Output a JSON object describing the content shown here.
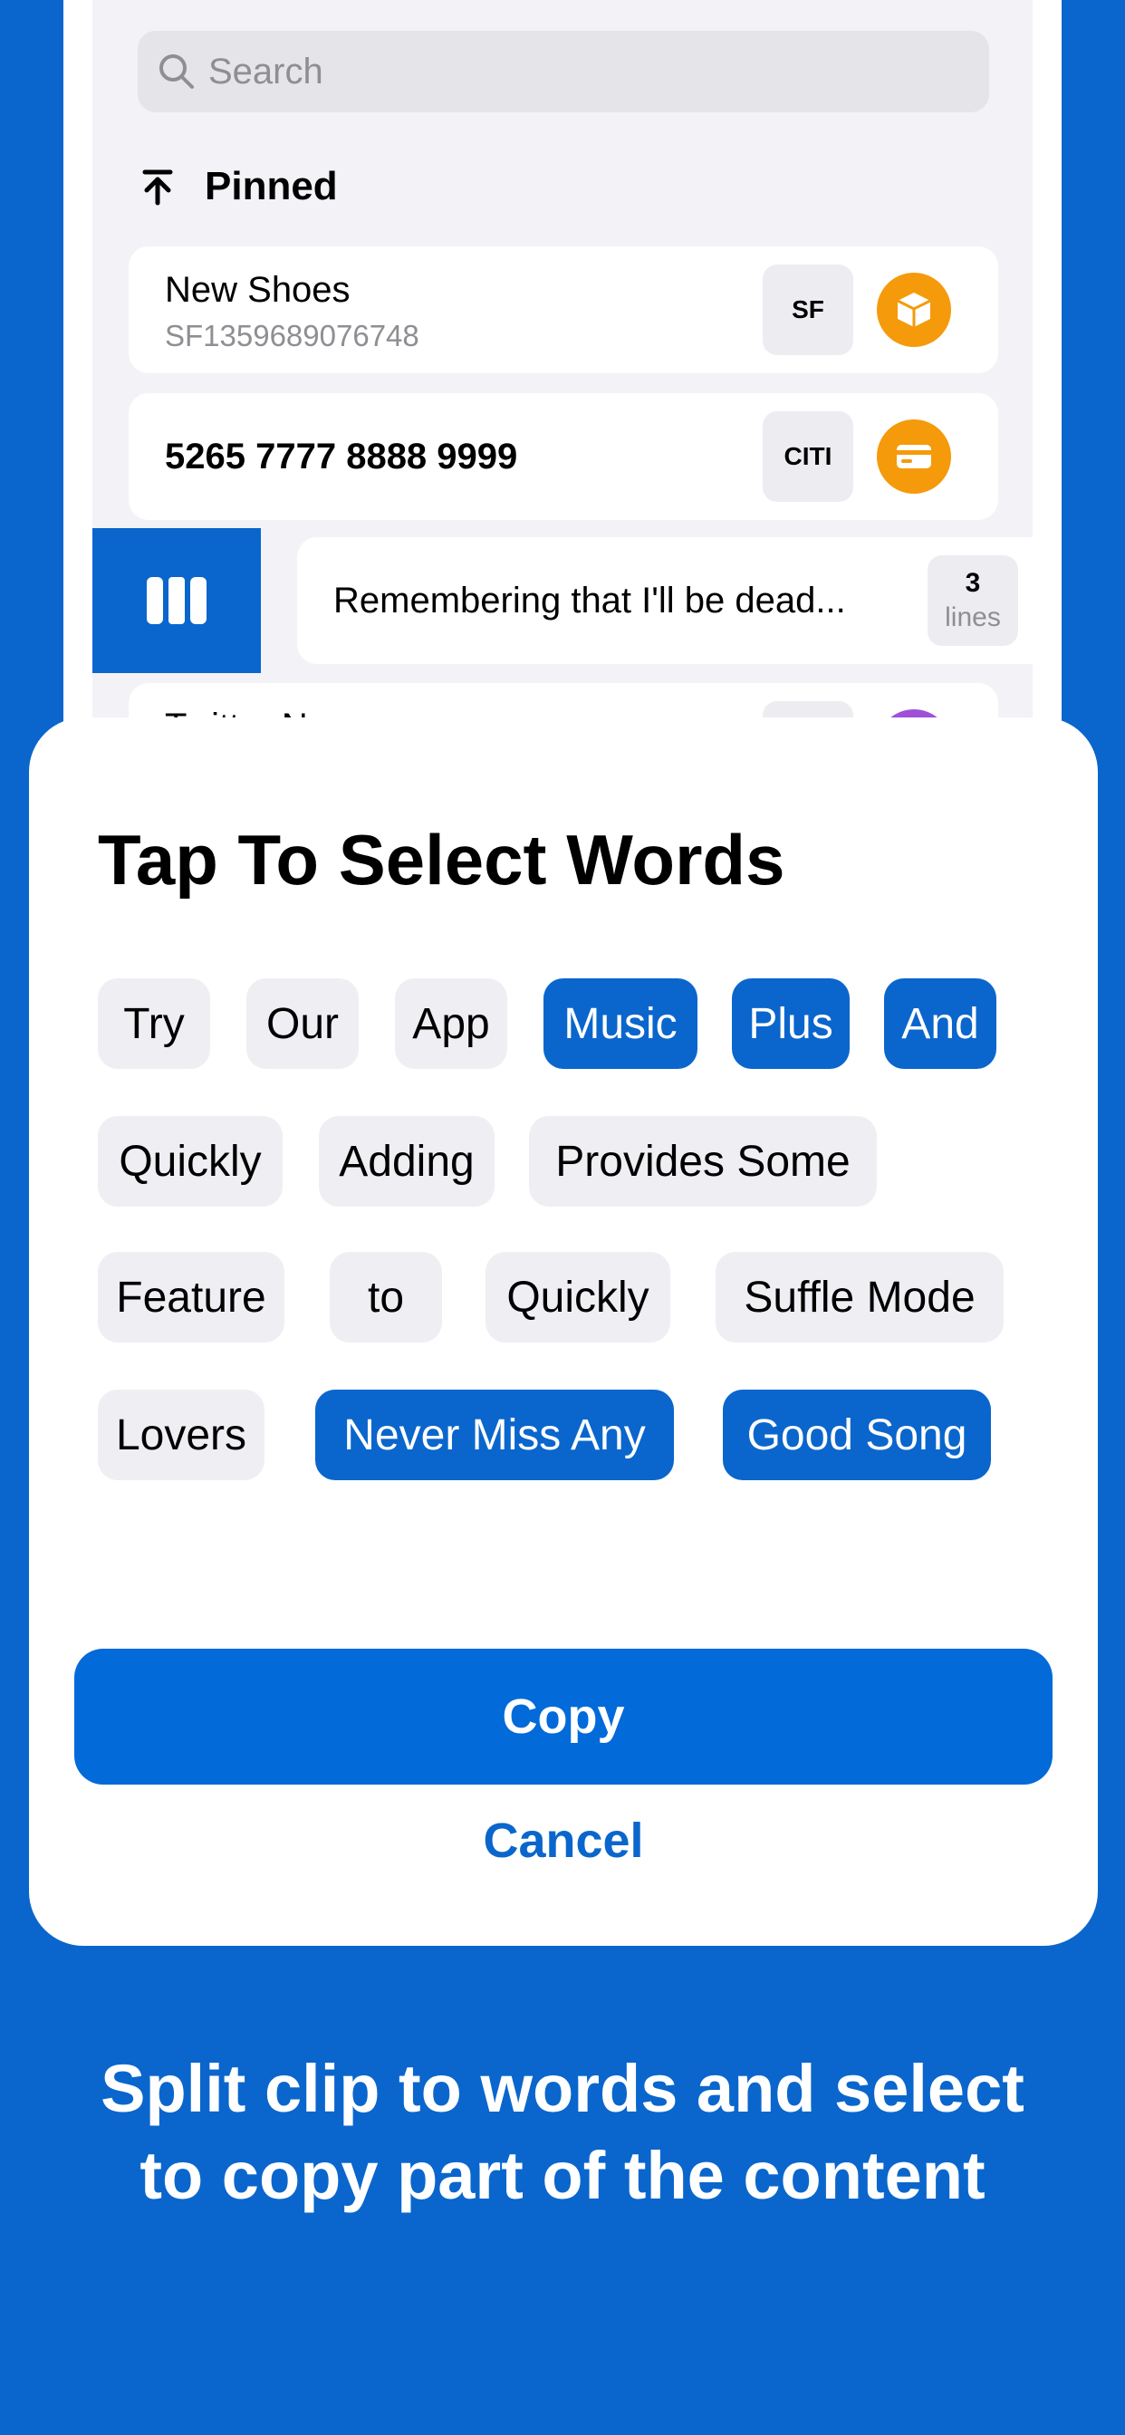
{
  "search": {
    "placeholder": "Search"
  },
  "pinned": {
    "header": "Pinned",
    "items": [
      {
        "title": "New Shoes",
        "subtitle": "SF1359689076748",
        "badge": "SF",
        "icon": "package-icon"
      },
      {
        "title": "5265 7777 8888 9999",
        "badge": "CITI",
        "icon": "credit-card-icon"
      },
      {
        "title": "Remembering that I'll be dead...",
        "lines_count": "3",
        "lines_label": "lines"
      },
      {
        "title": "Twitter Name",
        "icon": "purple-icon"
      }
    ]
  },
  "sheet": {
    "title": "Tap To Select Words",
    "words": [
      {
        "text": "Try",
        "selected": false
      },
      {
        "text": "Our",
        "selected": false
      },
      {
        "text": "App",
        "selected": false
      },
      {
        "text": "Music",
        "selected": true
      },
      {
        "text": "Plus",
        "selected": true
      },
      {
        "text": "And",
        "selected": true
      },
      {
        "text": "Quickly",
        "selected": false
      },
      {
        "text": "Adding",
        "selected": false
      },
      {
        "text": "Provides Some",
        "selected": false
      },
      {
        "text": "Feature",
        "selected": false
      },
      {
        "text": "to",
        "selected": false
      },
      {
        "text": "Quickly",
        "selected": false
      },
      {
        "text": "Suffle Mode",
        "selected": false
      },
      {
        "text": "Lovers",
        "selected": false
      },
      {
        "text": "Never Miss Any",
        "selected": true
      },
      {
        "text": "Good Song",
        "selected": true
      }
    ],
    "copy_label": "Copy",
    "cancel_label": "Cancel"
  },
  "caption": "Split clip to words and select to copy part of the content",
  "colors": {
    "accent": "#0A66CC",
    "orange": "#F59A0A",
    "purple": "#A050D8"
  }
}
